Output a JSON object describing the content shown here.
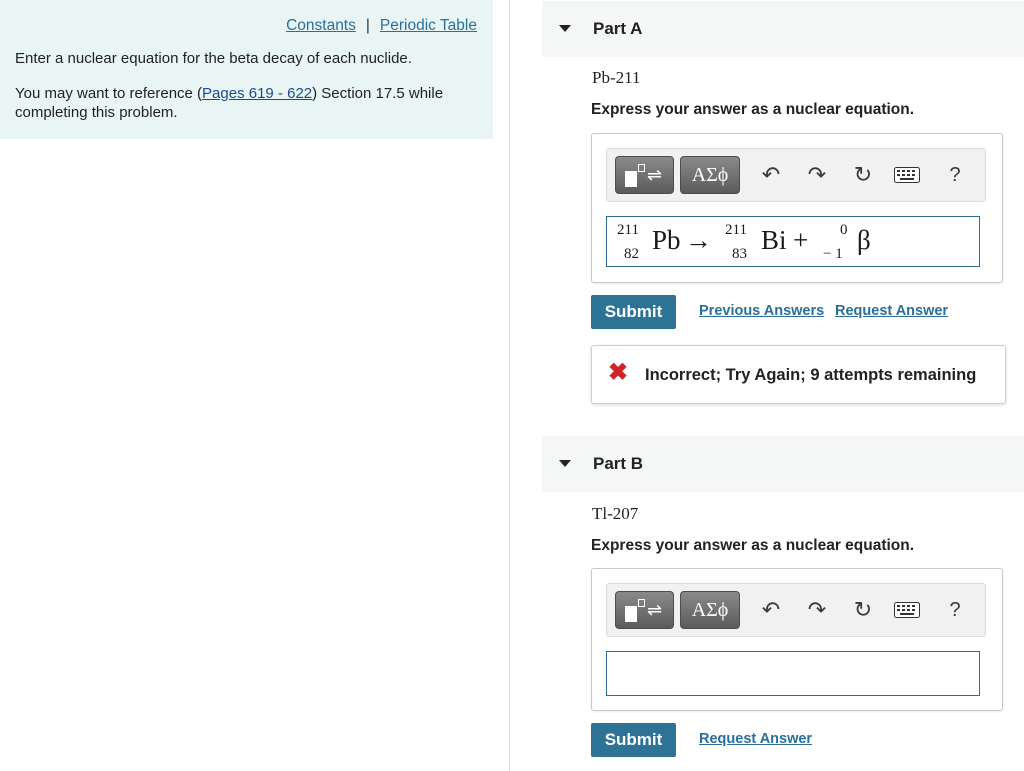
{
  "info": {
    "constants_link": "Constants",
    "separator": "|",
    "periodic_table_link": "Periodic Table",
    "intro": "Enter a nuclear equation for the beta decay of each nuclide.",
    "ref_pre": "You may want to reference (",
    "ref_link": "Pages 619 - 622",
    "ref_post": ") Section 17.5 while completing this problem."
  },
  "toolbar": {
    "greek_label": "ΑΣϕ",
    "help_label": "?"
  },
  "part_a": {
    "label": "Part A",
    "nuclide": "Pb-211",
    "instruction": "Express your answer as a nuclear equation.",
    "equation": {
      "reactant": {
        "mass": "211",
        "atomic": "82",
        "symbol": "Pb"
      },
      "arrow": "→",
      "product1": {
        "mass": "211",
        "atomic": "83",
        "symbol": "Bi"
      },
      "plus": "+",
      "product2": {
        "mass": "0",
        "atomic": "− 1",
        "symbol": "β"
      }
    },
    "submit_label": "Submit",
    "previous_answers_label": "Previous Answers",
    "request_answer_label": "Request Answer",
    "feedback": "Incorrect; Try Again; 9 attempts remaining"
  },
  "part_b": {
    "label": "Part B",
    "nuclide": "Tl-207",
    "instruction": "Express your answer as a nuclear equation.",
    "submit_label": "Submit",
    "request_answer_label": "Request Answer"
  },
  "colors": {
    "link": "#2a6f9a",
    "submit_bg": "#2d7396",
    "error": "#d2232a",
    "panel_bg": "#e9f4f4"
  }
}
